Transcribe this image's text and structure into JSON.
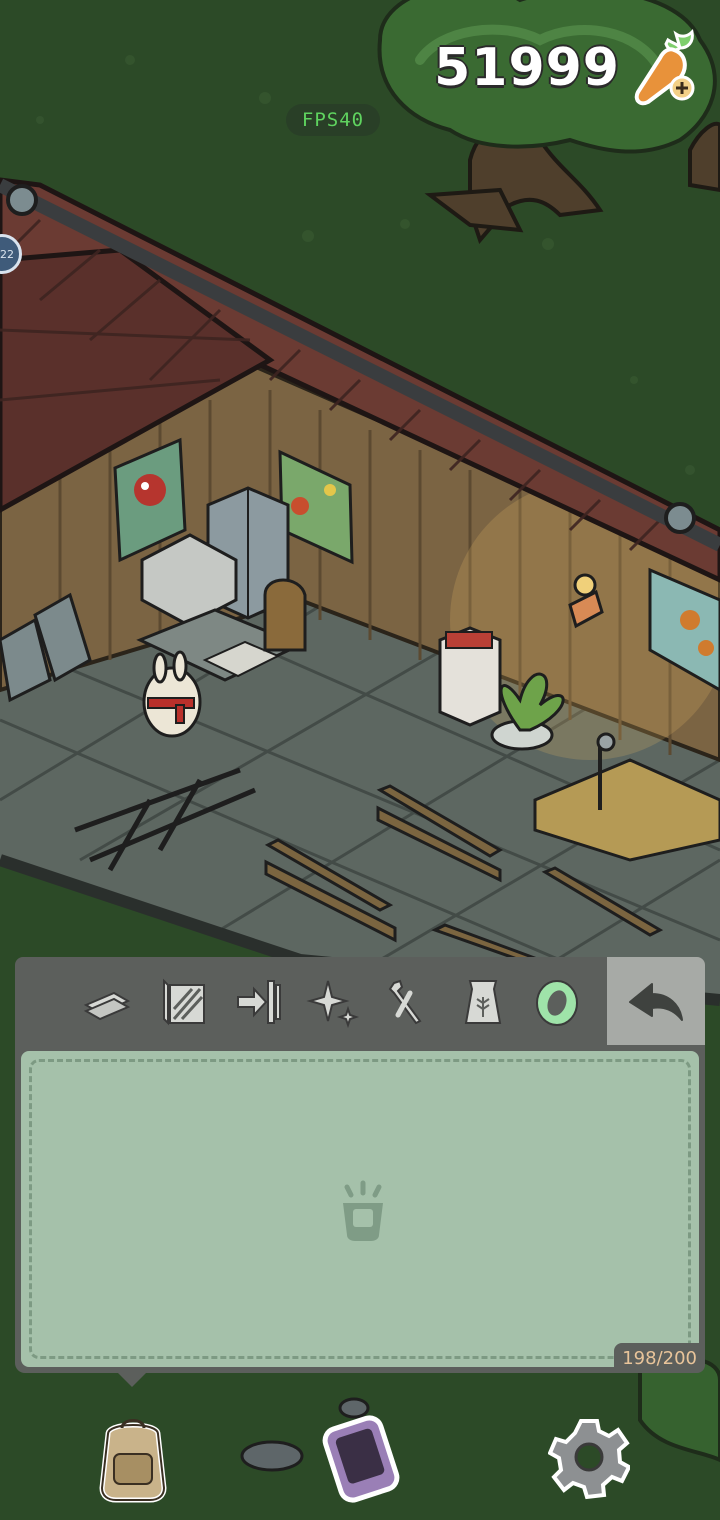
{
  "hud": {
    "currency_value": "51999",
    "fps_label": "FPS40"
  },
  "inventory": {
    "capacity": "198/200",
    "tabs": [
      {
        "name": "tab-flooring",
        "icon": "plank-stack-icon"
      },
      {
        "name": "tab-wallpaper",
        "icon": "wallpaper-icon"
      },
      {
        "name": "tab-wall-decor",
        "icon": "wall-decor-icon"
      },
      {
        "name": "tab-sparkle-decor",
        "icon": "sparkle-icon"
      },
      {
        "name": "tab-tools",
        "icon": "tools-icon"
      },
      {
        "name": "tab-seeds",
        "icon": "seed-bag-icon"
      },
      {
        "name": "tab-special",
        "icon": "ring-icon"
      }
    ],
    "back_icon": "back-arrow-icon",
    "empty_icon": "empty-box-icon"
  },
  "dock": {
    "backpack_icon": "backpack-icon",
    "phone_icon": "phone-icon",
    "settings_icon": "gear-icon"
  },
  "colors": {
    "grass": "#2c4a27",
    "panel": "#5c5f5c",
    "panel_inner": "#a5c1aa",
    "capacity_text": "#e8c49a",
    "fps_text": "#5fd35f"
  }
}
